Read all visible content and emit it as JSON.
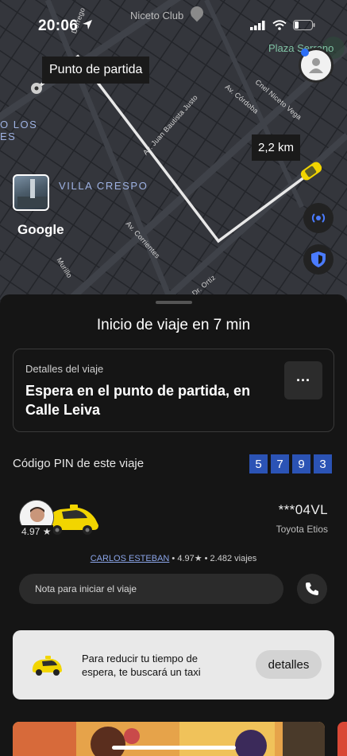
{
  "status_bar": {
    "time": "20:06"
  },
  "map": {
    "labels": {
      "niceto": "Niceto Club",
      "plaza": "Plaza Serrano",
      "dorrego": "Dorrego",
      "cordoba": "Av. Córdoba",
      "vega": "Cnel Niceto Vega",
      "justo": "Av. Juan Bautista Justo",
      "corrientes": "Av. Corrientes",
      "murillo": "Murillo",
      "ortiz": "Dr. Ortiz",
      "losres_1": "O LOS",
      "losres_2": "ES"
    },
    "pickup_callout": "Punto de partida",
    "distance": "2,2 km",
    "neighborhood": "VILLA CRESPO",
    "google_logo": "Google"
  },
  "sheet": {
    "title": "Inicio de viaje en 7 min",
    "details": {
      "label": "Detalles del viaje",
      "text": "Espera en el punto de partida, en Calle Leiva",
      "more": "···"
    },
    "pin": {
      "label": "Código PIN de este viaje",
      "digits": [
        "5",
        "7",
        "9",
        "3"
      ]
    },
    "driver": {
      "rating_chip": "4.97 ★",
      "plate": "***04VL",
      "model": "Toyota Etios",
      "name": "CARLOS ESTEBAN",
      "stats": " • 4.97★ • 2.482 viajes"
    },
    "note_placeholder": "Nota para iniciar el viaje",
    "promo": {
      "text": "Para reducir tu tiempo de espera, te buscará un taxi",
      "button": "detalles"
    }
  },
  "colors": {
    "accent_blue": "#2b53b5",
    "taxi_yellow": "#f2d500",
    "map_bg": "#2d2f35"
  }
}
